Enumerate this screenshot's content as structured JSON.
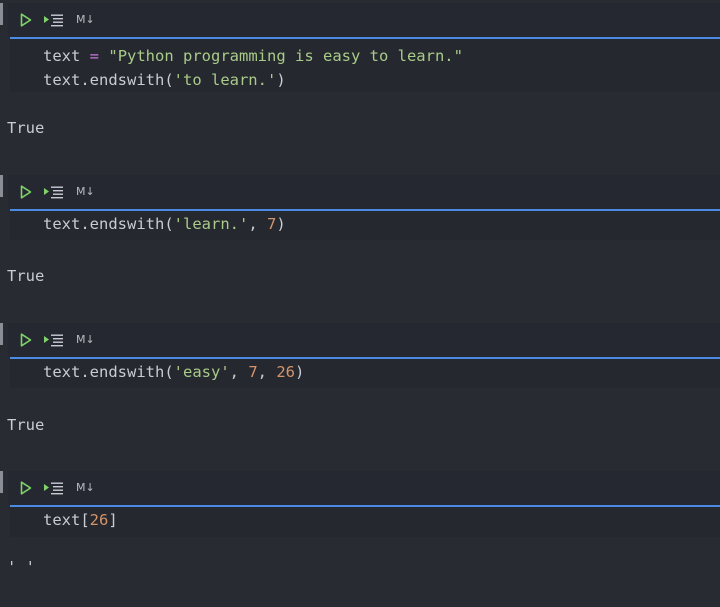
{
  "cells": [
    {
      "markdown_label": "M↓",
      "code": {
        "line1": {
          "name": "text",
          "op": "=",
          "str": "\"Python programming is easy to learn.\""
        },
        "line2": {
          "pre": "text.endswith(",
          "str": "'to learn.'",
          "post": ")"
        }
      },
      "output": "True"
    },
    {
      "markdown_label": "M↓",
      "code": {
        "pre": "text.endswith(",
        "str": "'learn.'",
        "sep1": ", ",
        "num1": "7",
        "post": ")"
      },
      "output": "True"
    },
    {
      "markdown_label": "M↓",
      "code": {
        "pre": "text.endswith(",
        "str": "'easy'",
        "sep1": ", ",
        "num1": "7",
        "sep2": ", ",
        "num2": "26",
        "post": ")"
      },
      "output": "True"
    },
    {
      "markdown_label": "M↓",
      "code": {
        "pre": "text[",
        "num1": "26",
        "post": "]"
      },
      "output": "' '"
    }
  ],
  "icons": {
    "run": "play-icon",
    "run_below": "run-below-icon",
    "play_color": "#7fd36a",
    "accent_color": "#4a8be3"
  }
}
